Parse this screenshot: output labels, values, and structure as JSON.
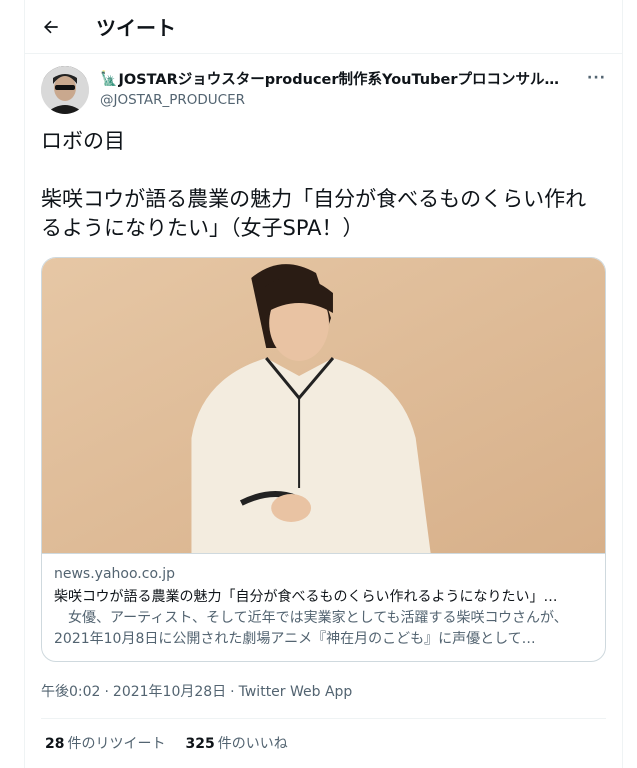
{
  "header": {
    "title": "ツイート",
    "back_icon": "arrow-left-icon"
  },
  "author": {
    "name": "JOSTARジョウスターproducer制作系YouTuberプロコンサルタ…",
    "badge_emoji": "🗽",
    "handle": "@JOSTAR_PRODUCER",
    "more_label": "···"
  },
  "tweet": {
    "text": "ロボの目\n\n柴咲コウが語る農業の魅力「自分が食べるものくらい作れるようになりたい」（女子SPA！）"
  },
  "card": {
    "domain": "news.yahoo.co.jp",
    "title": "柴咲コウが語る農業の魅力「自分が食べるものくらい作れるようになりたい」…",
    "description": "　女優、アーティスト、そして近年では実業家としても活躍する柴咲コウさんが、2021年10月8日に公開された劇場アニメ『神在月のこども』に声優として…"
  },
  "meta": {
    "time": "午後0:02",
    "date": "2021年10月28日",
    "source": "Twitter Web App",
    "separator": "·"
  },
  "stats": {
    "retweets": "28",
    "retweets_label": "件のリツイート",
    "likes": "325",
    "likes_label": "件のいいね"
  },
  "colors": {
    "text": "#0f1419",
    "secondary": "#536471",
    "border": "#cfd9de"
  }
}
